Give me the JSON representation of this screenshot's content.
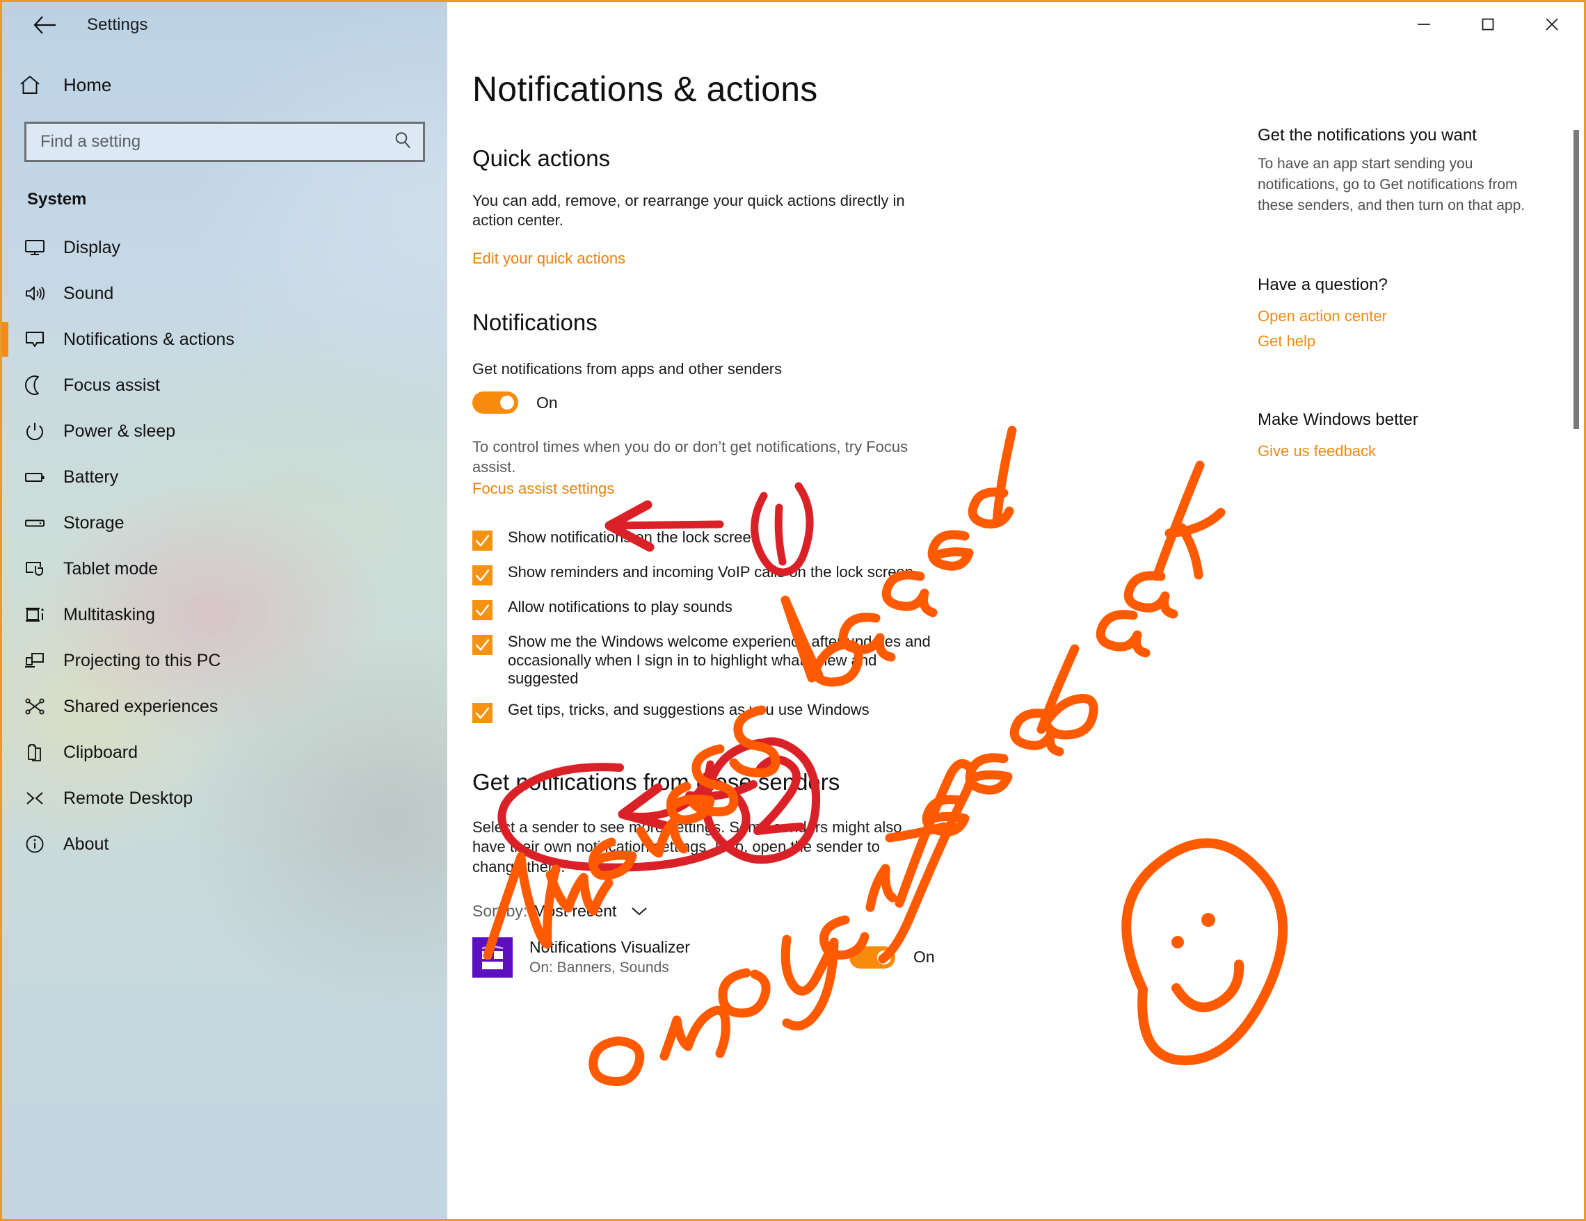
{
  "window": {
    "title": "Settings",
    "back_icon": "back-arrow-icon",
    "controls": {
      "minimize": "minimize-icon",
      "maximize": "maximize-icon",
      "close": "close-icon"
    },
    "accent_color": "#F28C18",
    "frame_border_color": "#E89A2B"
  },
  "sidebar": {
    "home_label": "Home",
    "home_icon": "home-icon",
    "search": {
      "placeholder": "Find a setting",
      "value": "",
      "icon": "search-icon"
    },
    "section_title": "System",
    "items": [
      {
        "label": "Display",
        "icon": "monitor-icon",
        "active": false
      },
      {
        "label": "Sound",
        "icon": "speaker-icon",
        "active": false
      },
      {
        "label": "Notifications & actions",
        "icon": "chat-bubble-icon",
        "active": true
      },
      {
        "label": "Focus assist",
        "icon": "moon-icon",
        "active": false
      },
      {
        "label": "Power & sleep",
        "icon": "power-icon",
        "active": false
      },
      {
        "label": "Battery",
        "icon": "battery-icon",
        "active": false
      },
      {
        "label": "Storage",
        "icon": "drive-icon",
        "active": false
      },
      {
        "label": "Tablet mode",
        "icon": "tablet-touch-icon",
        "active": false
      },
      {
        "label": "Multitasking",
        "icon": "multitask-icon",
        "active": false
      },
      {
        "label": "Projecting to this PC",
        "icon": "project-screen-icon",
        "active": false
      },
      {
        "label": "Shared experiences",
        "icon": "share-nodes-icon",
        "active": false
      },
      {
        "label": "Clipboard",
        "icon": "clipboard-icon",
        "active": false
      },
      {
        "label": "Remote Desktop",
        "icon": "remote-desktop-icon",
        "active": false
      },
      {
        "label": "About",
        "icon": "info-circle-icon",
        "active": false
      }
    ]
  },
  "main": {
    "page_title": "Notifications & actions",
    "quick_actions": {
      "heading": "Quick actions",
      "description": "You can add, remove, or rearrange your quick actions directly in action center.",
      "link": "Edit your quick actions"
    },
    "notifications": {
      "heading": "Notifications",
      "master_label": "Get notifications from apps and other senders",
      "master_state": "On",
      "focus_note": "To control times when you do or don’t get notifications, try Focus assist.",
      "focus_link": "Focus assist settings",
      "checkboxes": [
        {
          "label": "Show notifications on the lock screen",
          "checked": true
        },
        {
          "label": "Show reminders and incoming VoIP calls on the lock screen",
          "checked": true
        },
        {
          "label": "Allow notifications to play sounds",
          "checked": true
        },
        {
          "label": "Show me the Windows welcome experience after updates and occasionally when I sign in to highlight what’s new and suggested",
          "checked": true
        },
        {
          "label": "Get tips, tricks, and suggestions as you use Windows",
          "checked": true
        }
      ]
    },
    "senders": {
      "heading": "Get notifications from these senders",
      "description": "Select a sender to see more settings. Some senders might also have their own notification settings. If so, open the sender to change them.",
      "sort": {
        "prefix": "Sort by:",
        "value": "Most recent",
        "chevron_icon": "chevron-down-icon"
      },
      "list": [
        {
          "name": "Notifications Visualizer",
          "subtitle": "On: Banners, Sounds",
          "state": "On",
          "icon": "notifications-visualizer-app-icon",
          "icon_color": "#5B0FBE"
        }
      ]
    }
  },
  "aside": {
    "blocks": [
      {
        "heading": "Get the notifications you want",
        "text": "To have an app start sending you notifications, go to Get notifications from these senders, and then turn on that app."
      },
      {
        "heading": "Have a question?",
        "links": [
          "Open action center",
          "Get help"
        ]
      },
      {
        "heading": "Make Windows better",
        "links": [
          "Give us feedback"
        ]
      }
    ]
  },
  "annotations": {
    "ink_orange_color": "#FF5A00",
    "ink_red_color": "#DA2128",
    "handwriting_line1": "Newness based",
    "handwriting_line2": "on your feedback",
    "smiley": "smiley-face-drawing",
    "marker_1": "1",
    "marker_2": "2"
  }
}
